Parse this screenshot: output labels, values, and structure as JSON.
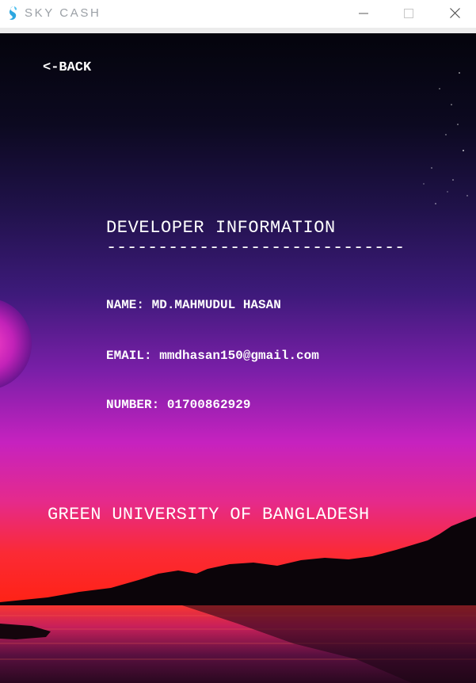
{
  "window": {
    "title": "SKY CASH",
    "controls": [
      "minimize-icon",
      "maximize-icon",
      "close-icon"
    ]
  },
  "nav": {
    "back_label": "<-BACK"
  },
  "developer": {
    "heading": "DEVELOPER INFORMATION",
    "divider": "-----------------------------",
    "name": "NAME: MD.MAHMUDUL HASAN",
    "email": "EMAIL: mmdhasan150@gmail.com",
    "number": "NUMBER: 01700862929"
  },
  "footer": {
    "university": "GREEN UNIVERSITY OF BANGLADESH"
  },
  "colors": {
    "sky_top": "#05050f",
    "sky_mid": "#3a1a78",
    "sky_magenta": "#c21fc0",
    "horizon_red": "#ff2a1a",
    "mountain": "#0a0408",
    "text": "#ffffff",
    "logo": "#2ea7e0"
  }
}
